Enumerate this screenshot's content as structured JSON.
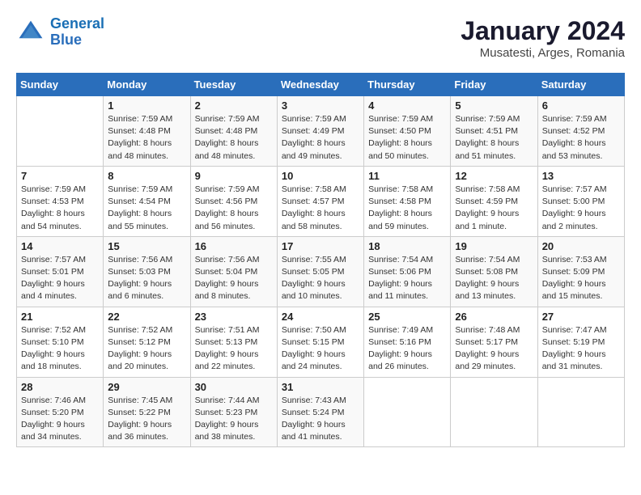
{
  "header": {
    "logo_line1": "General",
    "logo_line2": "Blue",
    "title": "January 2024",
    "subtitle": "Musatesti, Arges, Romania"
  },
  "weekdays": [
    "Sunday",
    "Monday",
    "Tuesday",
    "Wednesday",
    "Thursday",
    "Friday",
    "Saturday"
  ],
  "weeks": [
    [
      {
        "day": "",
        "info": ""
      },
      {
        "day": "1",
        "info": "Sunrise: 7:59 AM\nSunset: 4:48 PM\nDaylight: 8 hours\nand 48 minutes."
      },
      {
        "day": "2",
        "info": "Sunrise: 7:59 AM\nSunset: 4:48 PM\nDaylight: 8 hours\nand 48 minutes."
      },
      {
        "day": "3",
        "info": "Sunrise: 7:59 AM\nSunset: 4:49 PM\nDaylight: 8 hours\nand 49 minutes."
      },
      {
        "day": "4",
        "info": "Sunrise: 7:59 AM\nSunset: 4:50 PM\nDaylight: 8 hours\nand 50 minutes."
      },
      {
        "day": "5",
        "info": "Sunrise: 7:59 AM\nSunset: 4:51 PM\nDaylight: 8 hours\nand 51 minutes."
      },
      {
        "day": "6",
        "info": "Sunrise: 7:59 AM\nSunset: 4:52 PM\nDaylight: 8 hours\nand 53 minutes."
      }
    ],
    [
      {
        "day": "7",
        "info": "Sunrise: 7:59 AM\nSunset: 4:53 PM\nDaylight: 8 hours\nand 54 minutes."
      },
      {
        "day": "8",
        "info": "Sunrise: 7:59 AM\nSunset: 4:54 PM\nDaylight: 8 hours\nand 55 minutes."
      },
      {
        "day": "9",
        "info": "Sunrise: 7:59 AM\nSunset: 4:56 PM\nDaylight: 8 hours\nand 56 minutes."
      },
      {
        "day": "10",
        "info": "Sunrise: 7:58 AM\nSunset: 4:57 PM\nDaylight: 8 hours\nand 58 minutes."
      },
      {
        "day": "11",
        "info": "Sunrise: 7:58 AM\nSunset: 4:58 PM\nDaylight: 8 hours\nand 59 minutes."
      },
      {
        "day": "12",
        "info": "Sunrise: 7:58 AM\nSunset: 4:59 PM\nDaylight: 9 hours\nand 1 minute."
      },
      {
        "day": "13",
        "info": "Sunrise: 7:57 AM\nSunset: 5:00 PM\nDaylight: 9 hours\nand 2 minutes."
      }
    ],
    [
      {
        "day": "14",
        "info": "Sunrise: 7:57 AM\nSunset: 5:01 PM\nDaylight: 9 hours\nand 4 minutes."
      },
      {
        "day": "15",
        "info": "Sunrise: 7:56 AM\nSunset: 5:03 PM\nDaylight: 9 hours\nand 6 minutes."
      },
      {
        "day": "16",
        "info": "Sunrise: 7:56 AM\nSunset: 5:04 PM\nDaylight: 9 hours\nand 8 minutes."
      },
      {
        "day": "17",
        "info": "Sunrise: 7:55 AM\nSunset: 5:05 PM\nDaylight: 9 hours\nand 10 minutes."
      },
      {
        "day": "18",
        "info": "Sunrise: 7:54 AM\nSunset: 5:06 PM\nDaylight: 9 hours\nand 11 minutes."
      },
      {
        "day": "19",
        "info": "Sunrise: 7:54 AM\nSunset: 5:08 PM\nDaylight: 9 hours\nand 13 minutes."
      },
      {
        "day": "20",
        "info": "Sunrise: 7:53 AM\nSunset: 5:09 PM\nDaylight: 9 hours\nand 15 minutes."
      }
    ],
    [
      {
        "day": "21",
        "info": "Sunrise: 7:52 AM\nSunset: 5:10 PM\nDaylight: 9 hours\nand 18 minutes."
      },
      {
        "day": "22",
        "info": "Sunrise: 7:52 AM\nSunset: 5:12 PM\nDaylight: 9 hours\nand 20 minutes."
      },
      {
        "day": "23",
        "info": "Sunrise: 7:51 AM\nSunset: 5:13 PM\nDaylight: 9 hours\nand 22 minutes."
      },
      {
        "day": "24",
        "info": "Sunrise: 7:50 AM\nSunset: 5:15 PM\nDaylight: 9 hours\nand 24 minutes."
      },
      {
        "day": "25",
        "info": "Sunrise: 7:49 AM\nSunset: 5:16 PM\nDaylight: 9 hours\nand 26 minutes."
      },
      {
        "day": "26",
        "info": "Sunrise: 7:48 AM\nSunset: 5:17 PM\nDaylight: 9 hours\nand 29 minutes."
      },
      {
        "day": "27",
        "info": "Sunrise: 7:47 AM\nSunset: 5:19 PM\nDaylight: 9 hours\nand 31 minutes."
      }
    ],
    [
      {
        "day": "28",
        "info": "Sunrise: 7:46 AM\nSunset: 5:20 PM\nDaylight: 9 hours\nand 34 minutes."
      },
      {
        "day": "29",
        "info": "Sunrise: 7:45 AM\nSunset: 5:22 PM\nDaylight: 9 hours\nand 36 minutes."
      },
      {
        "day": "30",
        "info": "Sunrise: 7:44 AM\nSunset: 5:23 PM\nDaylight: 9 hours\nand 38 minutes."
      },
      {
        "day": "31",
        "info": "Sunrise: 7:43 AM\nSunset: 5:24 PM\nDaylight: 9 hours\nand 41 minutes."
      },
      {
        "day": "",
        "info": ""
      },
      {
        "day": "",
        "info": ""
      },
      {
        "day": "",
        "info": ""
      }
    ]
  ]
}
